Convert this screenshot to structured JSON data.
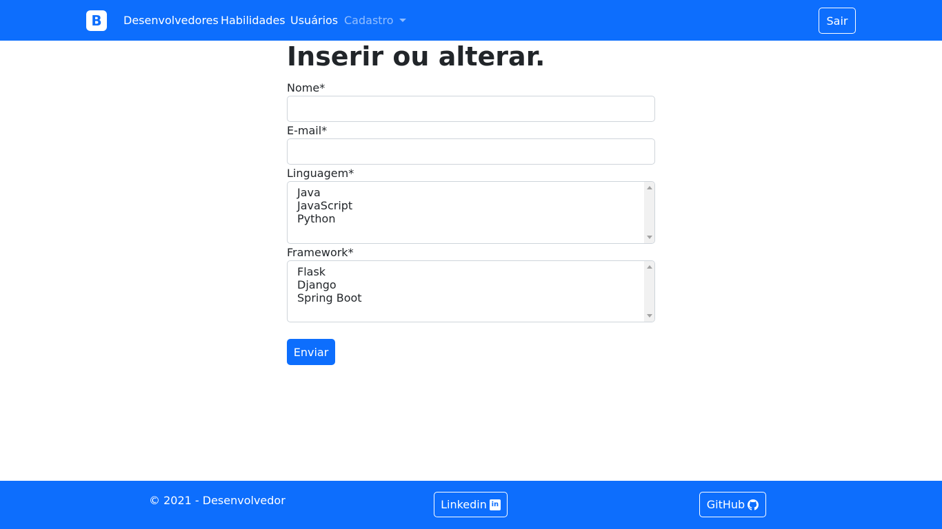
{
  "navbar": {
    "brand_letter": "B",
    "links": [
      {
        "label": "Desenvolvedores"
      },
      {
        "label": "Habilidades"
      },
      {
        "label": "Usuários"
      }
    ],
    "dropdown_label": "Cadastro",
    "logout_label": "Sair"
  },
  "form": {
    "title": "Inserir ou alterar.",
    "name_label": "Nome*",
    "name_value": "",
    "email_label": "E-mail*",
    "email_value": "",
    "language_label": "Linguagem*",
    "language_options": [
      "Java",
      "JavaScript",
      "Python"
    ],
    "framework_label": "Framework*",
    "framework_options": [
      "Flask",
      "Django",
      "Spring Boot"
    ],
    "submit_label": "Enviar"
  },
  "footer": {
    "copyright": "© 2021 - Desenvolvedor",
    "linkedin_label": "Linkedin",
    "linkedin_icon": "linkedin-icon",
    "github_label": "GitHub",
    "github_icon": "github-icon"
  },
  "colors": {
    "primary": "#0d6efd",
    "text": "#212529",
    "border": "#ced4da"
  }
}
